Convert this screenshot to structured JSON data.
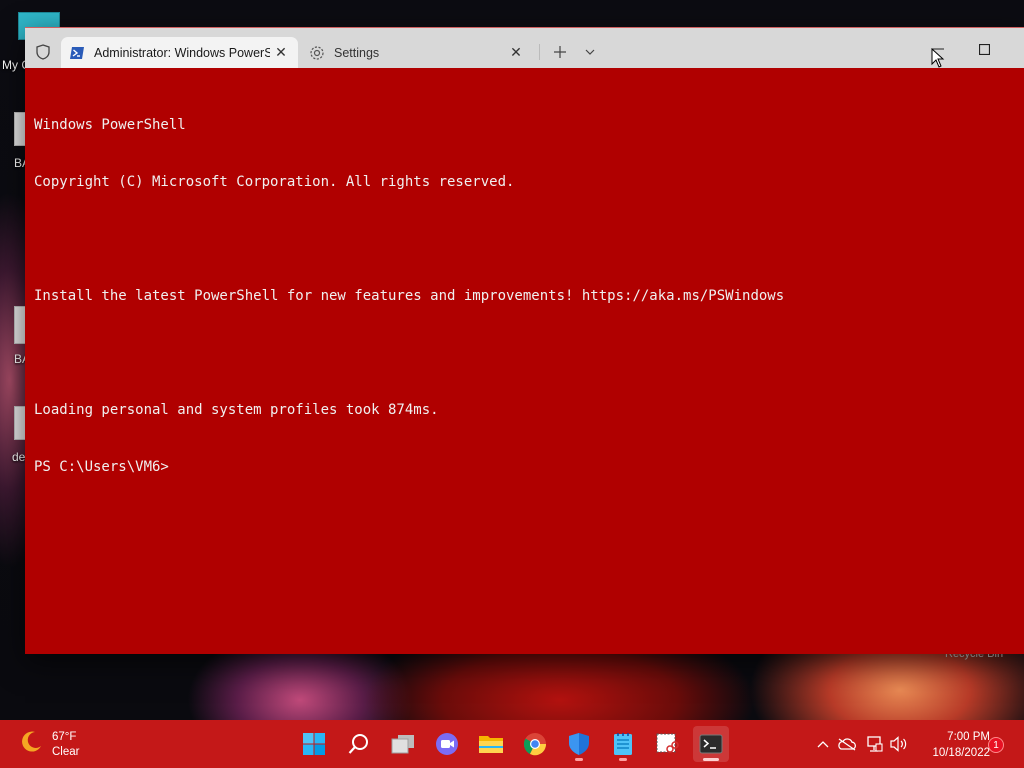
{
  "desktop": {
    "icons": [
      {
        "label": "My C"
      },
      {
        "label": "BA"
      },
      {
        "label": "BA"
      },
      {
        "label": "de"
      }
    ],
    "recycle_bin_label": "Recycle Bin"
  },
  "window": {
    "tabs": [
      {
        "title": "Administrator: Windows PowerShell",
        "icon": "powershell-icon",
        "active": true
      },
      {
        "title": "Settings",
        "icon": "gear-icon",
        "active": false
      }
    ],
    "new_tab_icon": "plus-icon",
    "dropdown_icon": "chevron-down-icon",
    "controls": [
      "minimize",
      "maximize"
    ]
  },
  "terminal": {
    "background": "#b00000",
    "foreground": "#f0f0f0",
    "lines": [
      "Windows PowerShell",
      "Copyright (C) Microsoft Corporation. All rights reserved.",
      "",
      "Install the latest PowerShell for new features and improvements! https://aka.ms/PSWindows",
      "",
      "Loading personal and system profiles took 874ms.",
      "PS C:\\Users\\VM6>"
    ]
  },
  "taskbar": {
    "color": "#c41818",
    "weather": {
      "temp": "67°F",
      "condition": "Clear",
      "icon": "moon-icon"
    },
    "apps": [
      {
        "name": "start",
        "icon": "windows-logo-icon"
      },
      {
        "name": "search",
        "icon": "search-icon"
      },
      {
        "name": "task-view",
        "icon": "task-view-icon"
      },
      {
        "name": "teams-chat",
        "icon": "video-chat-icon"
      },
      {
        "name": "file-explorer",
        "icon": "folder-icon"
      },
      {
        "name": "chrome",
        "icon": "chrome-icon"
      },
      {
        "name": "defender",
        "icon": "shield-icon"
      },
      {
        "name": "notepad",
        "icon": "notepad-icon"
      },
      {
        "name": "snipping-tool",
        "icon": "snipping-tool-icon"
      },
      {
        "name": "terminal",
        "icon": "terminal-icon"
      }
    ],
    "tray": [
      "chevron-up-icon",
      "onedrive-icon",
      "network-icon",
      "volume-icon"
    ],
    "clock": {
      "time": "7:00 PM",
      "date": "10/18/2022"
    },
    "notification_count": "1"
  }
}
